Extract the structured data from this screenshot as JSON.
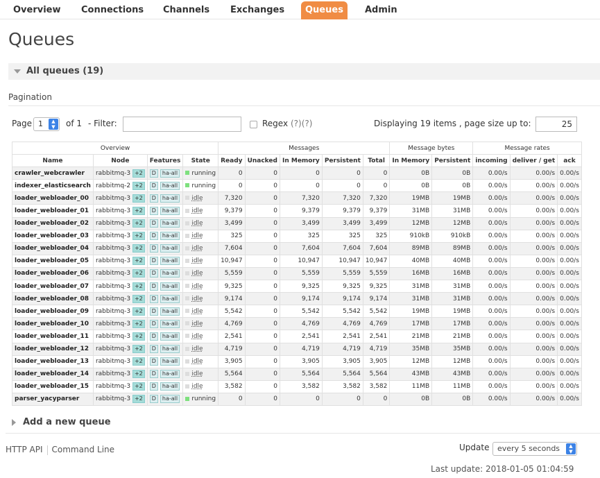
{
  "nav": {
    "tabs": [
      {
        "label": "Overview",
        "active": false
      },
      {
        "label": "Connections",
        "active": false
      },
      {
        "label": "Channels",
        "active": false
      },
      {
        "label": "Exchanges",
        "active": false
      },
      {
        "label": "Queues",
        "active": true
      },
      {
        "label": "Admin",
        "active": false
      }
    ]
  },
  "page_title": "Queues",
  "section_title": "All queues (19)",
  "pagination": {
    "label": "Pagination",
    "page_label": "Page",
    "page_value": "1",
    "of_label": "of 1",
    "filter_label": "- Filter:",
    "filter_value": "",
    "regex_label": "Regex",
    "regex_help": "(?)(?)",
    "displaying": "Displaying 19 items , page size up to:",
    "page_size": "25"
  },
  "table": {
    "group_headers": {
      "overview": "Overview",
      "messages": "Messages",
      "message_bytes": "Message bytes",
      "message_rates": "Message rates"
    },
    "columns": [
      "Name",
      "Node",
      "Features",
      "State",
      "Ready",
      "Unacked",
      "In Memory",
      "Persistent",
      "Total",
      "In Memory",
      "Persistent",
      "incoming",
      "deliver / get",
      "ack"
    ],
    "rows": [
      {
        "name": "crawler_webcrawler",
        "node": "rabbitmq-3",
        "plus": "+2",
        "d": "D",
        "ha": "ha-all",
        "state": "running",
        "ready": "0",
        "unacked": "0",
        "in_memory": "0",
        "persistent": "0",
        "total": "0",
        "bytes_mem": "0B",
        "bytes_pers": "0B",
        "incoming": "0.00/s",
        "deliver": "0.00/s",
        "ack": "0.00/s"
      },
      {
        "name": "indexer_elasticsearch",
        "node": "rabbitmq-2",
        "plus": "+2",
        "d": "D",
        "ha": "ha-all",
        "state": "running",
        "ready": "0",
        "unacked": "0",
        "in_memory": "0",
        "persistent": "0",
        "total": "0",
        "bytes_mem": "0B",
        "bytes_pers": "0B",
        "incoming": "0.00/s",
        "deliver": "0.00/s",
        "ack": "0.00/s"
      },
      {
        "name": "loader_webloader_00",
        "node": "rabbitmq-3",
        "plus": "+2",
        "d": "D",
        "ha": "ha-all",
        "state": "idle",
        "ready": "7,320",
        "unacked": "0",
        "in_memory": "7,320",
        "persistent": "7,320",
        "total": "7,320",
        "bytes_mem": "19MB",
        "bytes_pers": "19MB",
        "incoming": "0.00/s",
        "deliver": "0.00/s",
        "ack": "0.00/s"
      },
      {
        "name": "loader_webloader_01",
        "node": "rabbitmq-3",
        "plus": "+2",
        "d": "D",
        "ha": "ha-all",
        "state": "idle",
        "ready": "9,379",
        "unacked": "0",
        "in_memory": "9,379",
        "persistent": "9,379",
        "total": "9,379",
        "bytes_mem": "31MB",
        "bytes_pers": "31MB",
        "incoming": "0.00/s",
        "deliver": "0.00/s",
        "ack": "0.00/s"
      },
      {
        "name": "loader_webloader_02",
        "node": "rabbitmq-3",
        "plus": "+2",
        "d": "D",
        "ha": "ha-all",
        "state": "idle",
        "ready": "3,499",
        "unacked": "0",
        "in_memory": "3,499",
        "persistent": "3,499",
        "total": "3,499",
        "bytes_mem": "12MB",
        "bytes_pers": "12MB",
        "incoming": "0.00/s",
        "deliver": "0.00/s",
        "ack": "0.00/s"
      },
      {
        "name": "loader_webloader_03",
        "node": "rabbitmq-3",
        "plus": "+2",
        "d": "D",
        "ha": "ha-all",
        "state": "idle",
        "ready": "325",
        "unacked": "0",
        "in_memory": "325",
        "persistent": "325",
        "total": "325",
        "bytes_mem": "910kB",
        "bytes_pers": "910kB",
        "incoming": "0.00/s",
        "deliver": "0.00/s",
        "ack": "0.00/s"
      },
      {
        "name": "loader_webloader_04",
        "node": "rabbitmq-3",
        "plus": "+2",
        "d": "D",
        "ha": "ha-all",
        "state": "idle",
        "ready": "7,604",
        "unacked": "0",
        "in_memory": "7,604",
        "persistent": "7,604",
        "total": "7,604",
        "bytes_mem": "89MB",
        "bytes_pers": "89MB",
        "incoming": "0.00/s",
        "deliver": "0.00/s",
        "ack": "0.00/s"
      },
      {
        "name": "loader_webloader_05",
        "node": "rabbitmq-3",
        "plus": "+2",
        "d": "D",
        "ha": "ha-all",
        "state": "idle",
        "ready": "10,947",
        "unacked": "0",
        "in_memory": "10,947",
        "persistent": "10,947",
        "total": "10,947",
        "bytes_mem": "40MB",
        "bytes_pers": "40MB",
        "incoming": "0.00/s",
        "deliver": "0.00/s",
        "ack": "0.00/s"
      },
      {
        "name": "loader_webloader_06",
        "node": "rabbitmq-3",
        "plus": "+2",
        "d": "D",
        "ha": "ha-all",
        "state": "idle",
        "ready": "5,559",
        "unacked": "0",
        "in_memory": "5,559",
        "persistent": "5,559",
        "total": "5,559",
        "bytes_mem": "16MB",
        "bytes_pers": "16MB",
        "incoming": "0.00/s",
        "deliver": "0.00/s",
        "ack": "0.00/s"
      },
      {
        "name": "loader_webloader_07",
        "node": "rabbitmq-3",
        "plus": "+2",
        "d": "D",
        "ha": "ha-all",
        "state": "idle",
        "ready": "9,325",
        "unacked": "0",
        "in_memory": "9,325",
        "persistent": "9,325",
        "total": "9,325",
        "bytes_mem": "31MB",
        "bytes_pers": "31MB",
        "incoming": "0.00/s",
        "deliver": "0.00/s",
        "ack": "0.00/s"
      },
      {
        "name": "loader_webloader_08",
        "node": "rabbitmq-3",
        "plus": "+2",
        "d": "D",
        "ha": "ha-all",
        "state": "idle",
        "ready": "9,174",
        "unacked": "0",
        "in_memory": "9,174",
        "persistent": "9,174",
        "total": "9,174",
        "bytes_mem": "31MB",
        "bytes_pers": "31MB",
        "incoming": "0.00/s",
        "deliver": "0.00/s",
        "ack": "0.00/s"
      },
      {
        "name": "loader_webloader_09",
        "node": "rabbitmq-3",
        "plus": "+2",
        "d": "D",
        "ha": "ha-all",
        "state": "idle",
        "ready": "5,542",
        "unacked": "0",
        "in_memory": "5,542",
        "persistent": "5,542",
        "total": "5,542",
        "bytes_mem": "19MB",
        "bytes_pers": "19MB",
        "incoming": "0.00/s",
        "deliver": "0.00/s",
        "ack": "0.00/s"
      },
      {
        "name": "loader_webloader_10",
        "node": "rabbitmq-3",
        "plus": "+2",
        "d": "D",
        "ha": "ha-all",
        "state": "idle",
        "ready": "4,769",
        "unacked": "0",
        "in_memory": "4,769",
        "persistent": "4,769",
        "total": "4,769",
        "bytes_mem": "17MB",
        "bytes_pers": "17MB",
        "incoming": "0.00/s",
        "deliver": "0.00/s",
        "ack": "0.00/s"
      },
      {
        "name": "loader_webloader_11",
        "node": "rabbitmq-3",
        "plus": "+2",
        "d": "D",
        "ha": "ha-all",
        "state": "idle",
        "ready": "2,541",
        "unacked": "0",
        "in_memory": "2,541",
        "persistent": "2,541",
        "total": "2,541",
        "bytes_mem": "21MB",
        "bytes_pers": "21MB",
        "incoming": "0.00/s",
        "deliver": "0.00/s",
        "ack": "0.00/s"
      },
      {
        "name": "loader_webloader_12",
        "node": "rabbitmq-3",
        "plus": "+2",
        "d": "D",
        "ha": "ha-all",
        "state": "idle",
        "ready": "4,719",
        "unacked": "0",
        "in_memory": "4,719",
        "persistent": "4,719",
        "total": "4,719",
        "bytes_mem": "35MB",
        "bytes_pers": "35MB",
        "incoming": "0.00/s",
        "deliver": "0.00/s",
        "ack": "0.00/s"
      },
      {
        "name": "loader_webloader_13",
        "node": "rabbitmq-3",
        "plus": "+2",
        "d": "D",
        "ha": "ha-all",
        "state": "idle",
        "ready": "3,905",
        "unacked": "0",
        "in_memory": "3,905",
        "persistent": "3,905",
        "total": "3,905",
        "bytes_mem": "12MB",
        "bytes_pers": "12MB",
        "incoming": "0.00/s",
        "deliver": "0.00/s",
        "ack": "0.00/s"
      },
      {
        "name": "loader_webloader_14",
        "node": "rabbitmq-3",
        "plus": "+2",
        "d": "D",
        "ha": "ha-all",
        "state": "idle",
        "ready": "5,564",
        "unacked": "0",
        "in_memory": "5,564",
        "persistent": "5,564",
        "total": "5,564",
        "bytes_mem": "43MB",
        "bytes_pers": "43MB",
        "incoming": "0.00/s",
        "deliver": "0.00/s",
        "ack": "0.00/s"
      },
      {
        "name": "loader_webloader_15",
        "node": "rabbitmq-3",
        "plus": "+2",
        "d": "D",
        "ha": "ha-all",
        "state": "idle",
        "ready": "3,582",
        "unacked": "0",
        "in_memory": "3,582",
        "persistent": "3,582",
        "total": "3,582",
        "bytes_mem": "11MB",
        "bytes_pers": "11MB",
        "incoming": "0.00/s",
        "deliver": "0.00/s",
        "ack": "0.00/s"
      },
      {
        "name": "parser_yacyparser",
        "node": "rabbitmq-3",
        "plus": "+2",
        "d": "D",
        "ha": "ha-all",
        "state": "running",
        "ready": "0",
        "unacked": "0",
        "in_memory": "0",
        "persistent": "0",
        "total": "0",
        "bytes_mem": "0B",
        "bytes_pers": "0B",
        "incoming": "0.00/s",
        "deliver": "0.00/s",
        "ack": "0.00/s"
      }
    ]
  },
  "add_queue_label": "Add a new queue",
  "footer": {
    "http_api": "HTTP API",
    "command_line": "Command Line",
    "update_label": "Update",
    "update_value": "every 5 seconds",
    "last_update": "Last update: 2018-01-05 01:04:59"
  },
  "colors": {
    "accent": "#f08c44",
    "running": "#7ee07e",
    "idle": "#dddddd",
    "tag": "#a5dcd8"
  }
}
